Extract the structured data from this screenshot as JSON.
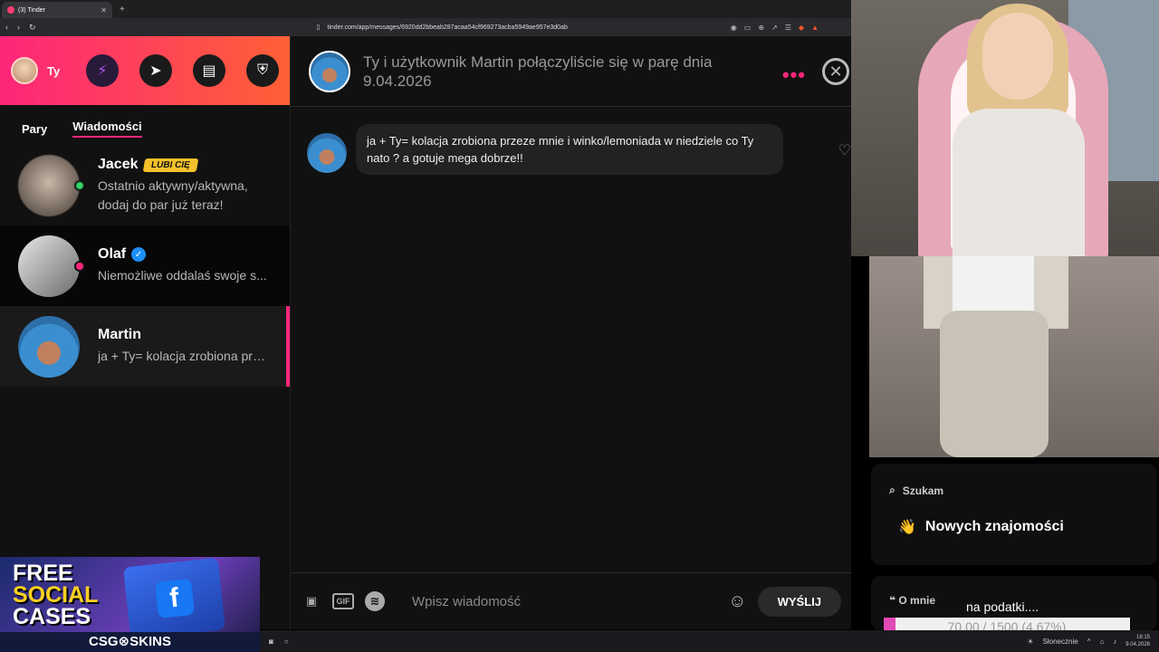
{
  "browser": {
    "tab_title": "(3) Tinder",
    "url": "tinder.com/app/messages/6920dd2bbeab287acaa54cf969273acba5949ae957e3d0ab"
  },
  "sidebar": {
    "user_name": "Ty",
    "tabs": [
      "Pary",
      "Wiadomości"
    ],
    "conversations": [
      {
        "name": "Jacek",
        "badge": "LUBI CIĘ",
        "message": "Ostatnio aktywny/aktywna, dodaj do par już teraz!"
      },
      {
        "name": "Olaf",
        "message": "Niemożliwe oddalaś swoje s..."
      },
      {
        "name": "Martin",
        "message": "ja + Ty= kolacja zrobiona prz..."
      }
    ]
  },
  "chat": {
    "match_text": "Ty i użytkownik Martin połączyliście się w parę dnia 9.04.2026",
    "message": "ja + Ty= kolacja zrobiona przeze mnie i winko/lemoniada w niedziele co Ty nato ? a gotuje mega dobrze!!",
    "input_placeholder": "Wpisz wiadomość",
    "gif_label": "GIF",
    "send_label": "WYŚLIJ"
  },
  "promo": {
    "line1": "FREE",
    "line2": "SOCIAL",
    "line3": "CASES",
    "logo": "CSG⊗SKINS"
  },
  "profile_card": {
    "looking_label": "Szukam",
    "looking_value": "Nowych znajomości",
    "about_label": "O mnie",
    "about_text": "na podatki...."
  },
  "goal": {
    "text": "70.00 / 1500 (4.67%)",
    "fraction": 0.0467
  },
  "taskbar": {
    "weather": "Słonecznie",
    "time": "18:15",
    "date": "9.04.2026"
  }
}
